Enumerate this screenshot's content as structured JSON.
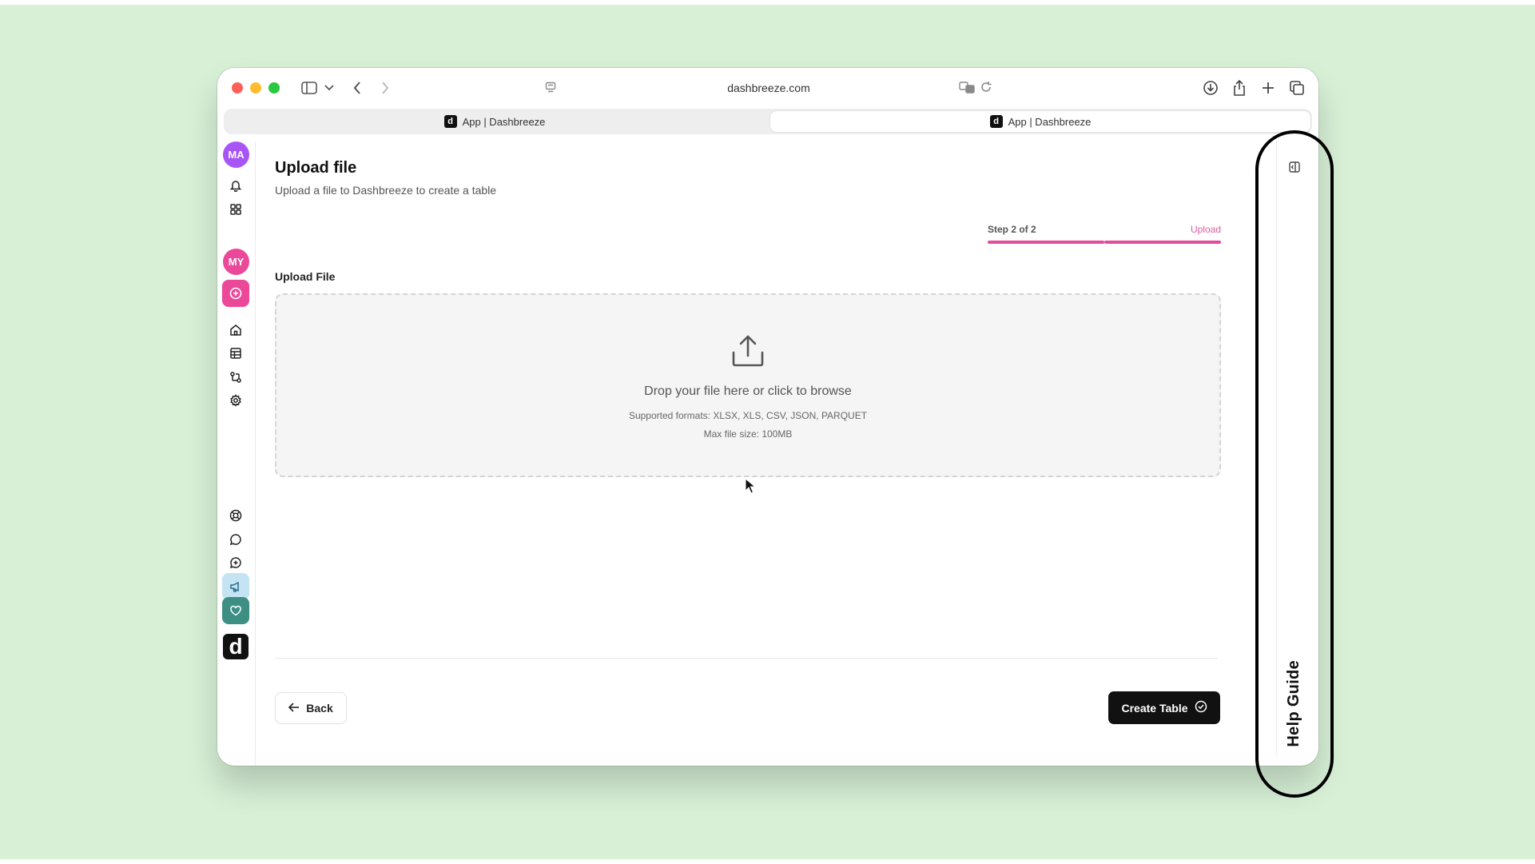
{
  "browser": {
    "url": "dashbreeze.com",
    "tabs": [
      {
        "label": "App | Dashbreeze",
        "favicon": "d"
      },
      {
        "label": "App | Dashbreeze",
        "favicon": "d"
      }
    ]
  },
  "sidebar": {
    "user_avatar": "MA",
    "workspace_avatar": "MY",
    "logo": "d"
  },
  "main": {
    "title": "Upload file",
    "subtitle": "Upload a file to Dashbreeze to create a table",
    "step": {
      "label": "Step 2 of 2",
      "name": "Upload",
      "current": 2,
      "total": 2
    },
    "upload_label": "Upload File",
    "dropzone": {
      "title": "Drop your file here or click to browse",
      "formats": "Supported formats: XLSX, XLS, CSV, JSON, PARQUET",
      "max_size": "Max file size: 100MB"
    },
    "back_label": "Back",
    "create_label": "Create Table"
  },
  "help_panel": {
    "label": "Help Guide"
  },
  "colors": {
    "accent_pink": "#e24c9b",
    "background": "#d7f0d6",
    "primary_button": "#111111"
  }
}
